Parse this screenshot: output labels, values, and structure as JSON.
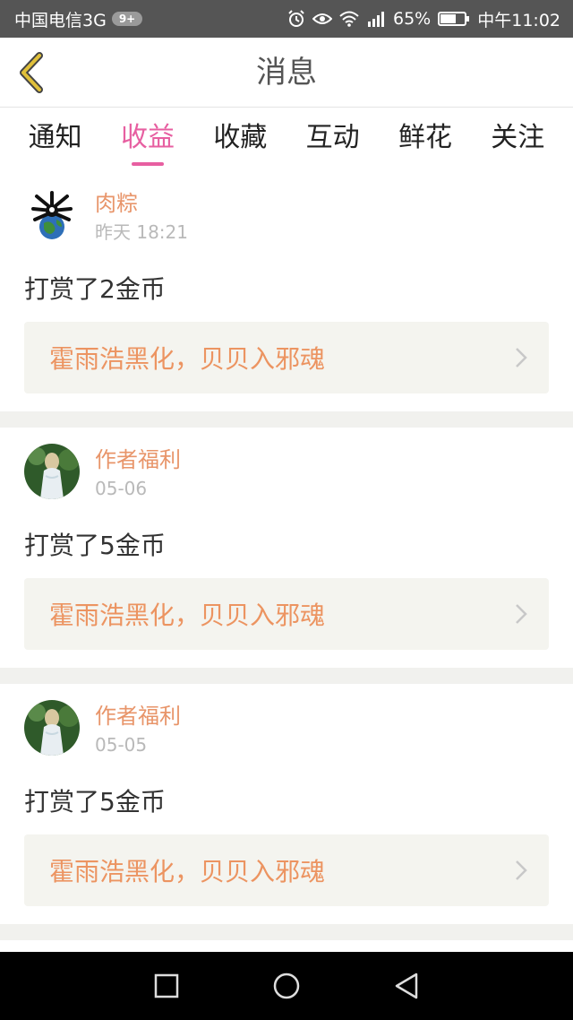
{
  "status_bar": {
    "carrier": "中国电信3G",
    "badge": "9+",
    "battery": "65%",
    "time": "中午11:02"
  },
  "header": {
    "title": "消息"
  },
  "tabs": [
    {
      "label": "通知"
    },
    {
      "label": "收益"
    },
    {
      "label": "收藏"
    },
    {
      "label": "互动"
    },
    {
      "label": "鲜花"
    },
    {
      "label": "关注"
    }
  ],
  "active_tab": "收益",
  "messages": [
    {
      "user": "肉粽",
      "time": "昨天 18:21",
      "action": "打赏了2金币",
      "book": "霍雨浩黑化，贝贝入邪魂"
    },
    {
      "user": "作者福利",
      "time": "05-06",
      "action": "打赏了5金币",
      "book": "霍雨浩黑化，贝贝入邪魂"
    },
    {
      "user": "作者福利",
      "time": "05-05",
      "action": "打赏了5金币",
      "book": "霍雨浩黑化，贝贝入邪魂"
    }
  ],
  "colors": {
    "accent_pink": "#e75fa1",
    "username_orange": "#e8956a",
    "book_orange": "#ec9461",
    "back_arrow": "#d8b52a"
  }
}
